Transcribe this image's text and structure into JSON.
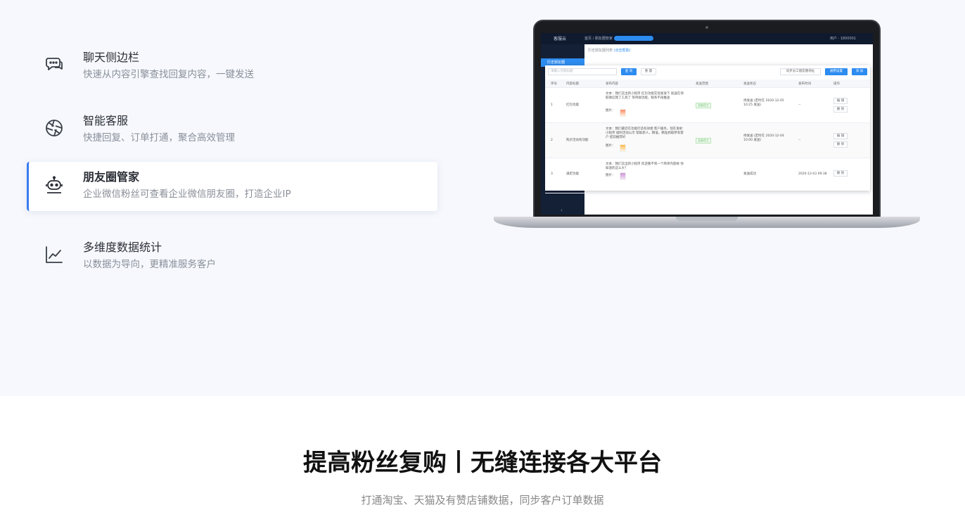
{
  "features": [
    {
      "title": "聊天侧边栏",
      "desc": "快速从内容引擎查找回复内容，一键发送",
      "icon": "chat-bubbles-icon",
      "active": false
    },
    {
      "title": "智能客服",
      "desc": "快捷回复、订单打通，聚合高效管理",
      "icon": "aperture-icon",
      "active": false
    },
    {
      "title": "朋友圈管家",
      "desc": "企业微信粉丝可查看企业微信朋友圈，打造企业IP",
      "icon": "robot-icon",
      "active": true
    },
    {
      "title": "多维度数据统计",
      "desc": "以数据为导向，更精准服务客户",
      "icon": "line-chart-icon",
      "active": false
    }
  ],
  "screen": {
    "app_name": "客服云",
    "breadcrumb": "首页 / 朋友圈管家",
    "user": "用户 · 1800001",
    "sidebar_active": "历史朋友圈",
    "subtitle": "历史朋友圈列表",
    "subtitle_link": "(点击帮助)",
    "search_placeholder": "请输入内容标题",
    "buttons": {
      "search": "查 询",
      "reset": "重 置",
      "sync": "同步员工朋友圈地址",
      "settings": "通用设置",
      "add": "添 加"
    },
    "columns": [
      "序号",
      "内容标题",
      "发布内容",
      "发送范围",
      "发送状态",
      "发布时间",
      "操作"
    ],
    "rows": [
      {
        "index": "1",
        "title": "红包功能",
        "content": "文本：我们又出新小程序 红包功能实现发放下 就送在领取微信我了工具了 等待收功能，联系不再推送",
        "img_label": "图片：",
        "scope": "全部员工",
        "status": "待发送 (定时在 2020-12-05 10:25 发送)",
        "time": "--",
        "actions": [
          "编 辑",
          "删 除"
        ]
      },
      {
        "index": "2",
        "title": "购买活动有功能",
        "content": "文本：我们最近在功能打造有效相 客户服务，现在发射小程序 福利活动公示 帮助新人，精准，精准抓取所有客户 提前推荐好",
        "img_label": "图片：",
        "scope": "全部员工",
        "status": "待发送 (定时在 2020-12-04 10:00 发送)",
        "time": "--",
        "actions": [
          "编 辑",
          "删 除"
        ]
      },
      {
        "index": "3",
        "title": "满足功能",
        "content": "文本：我们又出新小程序 欢迎看不到一个简单内容样 你知道的这么大?",
        "img_label": "图片：",
        "scope": "全部员工",
        "status": "发送成功",
        "time": "2020-12-03 09:38",
        "actions": [
          "删 除"
        ]
      }
    ]
  },
  "section": {
    "headline": "提高粉丝复购丨无缝连接各大平台",
    "subline": "打通淘宝、天猫及有赞店铺数据，同步客户订单数据"
  }
}
